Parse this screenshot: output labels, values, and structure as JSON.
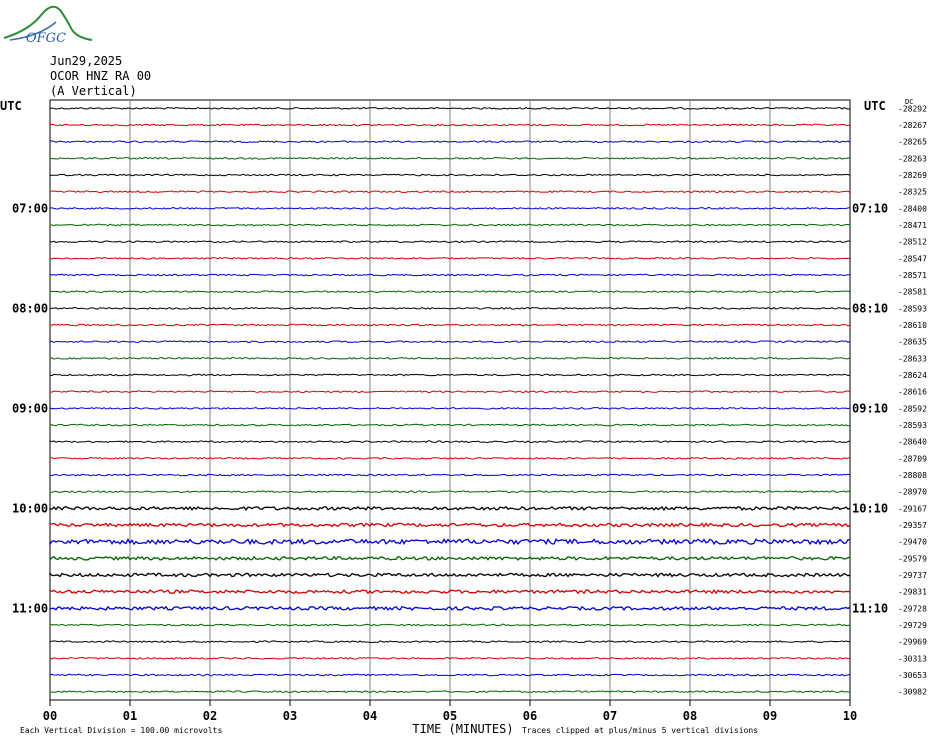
{
  "header": {
    "logo_text": "OFGC",
    "date": "Jun29,2025",
    "station": "OCOR HNZ RA 00",
    "component": "(A Vertical)"
  },
  "chart_data": {
    "type": "line",
    "title": "",
    "xlabel": "TIME (MINUTES)",
    "ylabel": "",
    "xlim": [
      0,
      10
    ],
    "x_ticks": [
      "00",
      "01",
      "02",
      "03",
      "04",
      "05",
      "06",
      "07",
      "08",
      "09",
      "10"
    ],
    "grid": true,
    "left_axis_label": "UTC",
    "right_axis_label": "UTC",
    "dc_label": "DC",
    "left_hour_labels": [
      {
        "row": 6,
        "text": "07:00"
      },
      {
        "row": 12,
        "text": "08:00"
      },
      {
        "row": 18,
        "text": "09:00"
      },
      {
        "row": 24,
        "text": "10:00"
      },
      {
        "row": 30,
        "text": "11:00"
      }
    ],
    "right_hour_labels": [
      {
        "row": 6,
        "text": "07:10"
      },
      {
        "row": 12,
        "text": "08:10"
      },
      {
        "row": 18,
        "text": "09:10"
      },
      {
        "row": 24,
        "text": "10:10"
      },
      {
        "row": 30,
        "text": "11:10"
      }
    ],
    "trace_colors": [
      "#000000",
      "#d00000",
      "#0000d0",
      "#006400"
    ],
    "dc_offsets": [
      "-28292",
      "-28267",
      "-28265",
      "-28263",
      "-28269",
      "-28325",
      "-28400",
      "-28471",
      "-28512",
      "-28547",
      "-28571",
      "-28581",
      "-28593",
      "-28610",
      "-28635",
      "-28633",
      "-28624",
      "-28616",
      "-28592",
      "-28593",
      "-28640",
      "-28709",
      "-28808",
      "-28970",
      "-29167",
      "-29357",
      "-29470",
      "-29579",
      "-29737",
      "-29831",
      "-29728",
      "-29729",
      "-29969",
      "-30313",
      "-30653",
      "-30982"
    ],
    "noise_levels": [
      1,
      1,
      1,
      1,
      1,
      1,
      1,
      1,
      1,
      1,
      1,
      1,
      1,
      1,
      1,
      1,
      1,
      1,
      1,
      1,
      1,
      1,
      1,
      1,
      2,
      2,
      3,
      2,
      2,
      2,
      2,
      1,
      1,
      1,
      1,
      1
    ],
    "footer_left": "Each Vertical Division =  100.00 microvolts",
    "footer_right": "Traces clipped at plus/minus 5 vertical divisions"
  }
}
